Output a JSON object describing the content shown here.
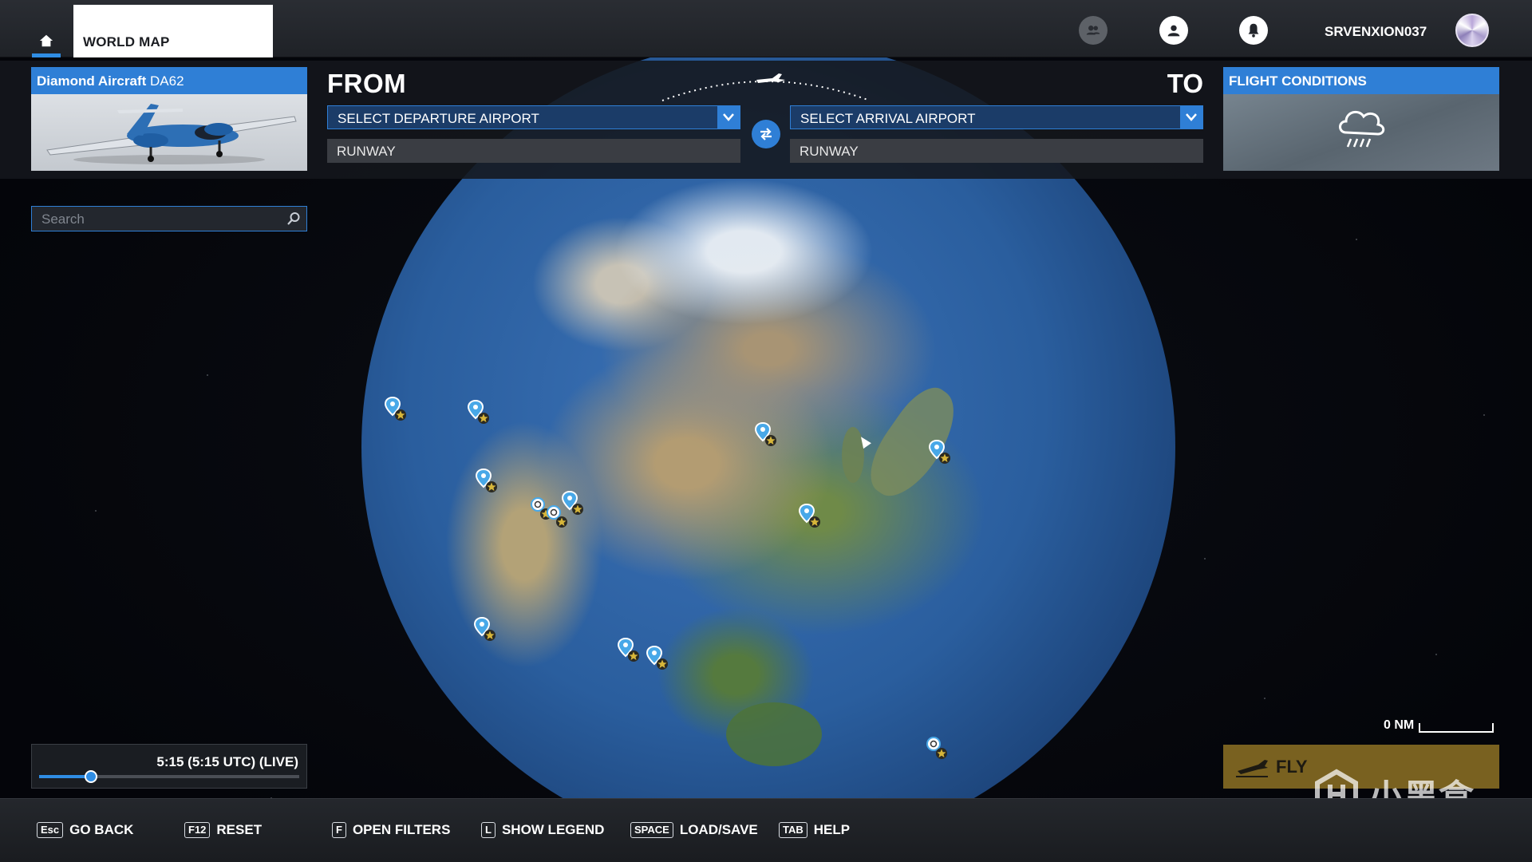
{
  "header": {
    "active_tab": "WORLD MAP",
    "username": "SRVENXION037"
  },
  "aircraft": {
    "brand": "Diamond Aircraft",
    "model": "DA62"
  },
  "route": {
    "from_label": "FROM",
    "to_label": "TO",
    "departure_select": "SELECT DEPARTURE AIRPORT",
    "departure_runway": "RUNWAY",
    "arrival_select": "SELECT ARRIVAL AIRPORT",
    "arrival_runway": "RUNWAY"
  },
  "conditions": {
    "title": "FLIGHT CONDITIONS",
    "weather_icon": "rain-cloud-icon"
  },
  "search": {
    "placeholder": "Search"
  },
  "time": {
    "label": "5:15 (5:15 UTC) (LIVE)",
    "slider_fraction": 0.2
  },
  "map": {
    "scale_label": "0 NM"
  },
  "fly": {
    "label": "FLY"
  },
  "watermark": {
    "text": "小黑盒"
  },
  "footer": {
    "items": [
      {
        "key": "Esc",
        "label": "GO BACK"
      },
      {
        "key": "F12",
        "label": "RESET"
      },
      {
        "key": "F",
        "label": "OPEN FILTERS"
      },
      {
        "key": "L",
        "label": "SHOW LEGEND"
      },
      {
        "key": "SPACE",
        "label": "LOAD/SAVE"
      },
      {
        "key": "TAB",
        "label": "HELP"
      }
    ]
  },
  "colors": {
    "accent": "#2f7fd6",
    "fly": "#a08028",
    "pin": "#48a8e8",
    "star": "#d7b63a"
  }
}
